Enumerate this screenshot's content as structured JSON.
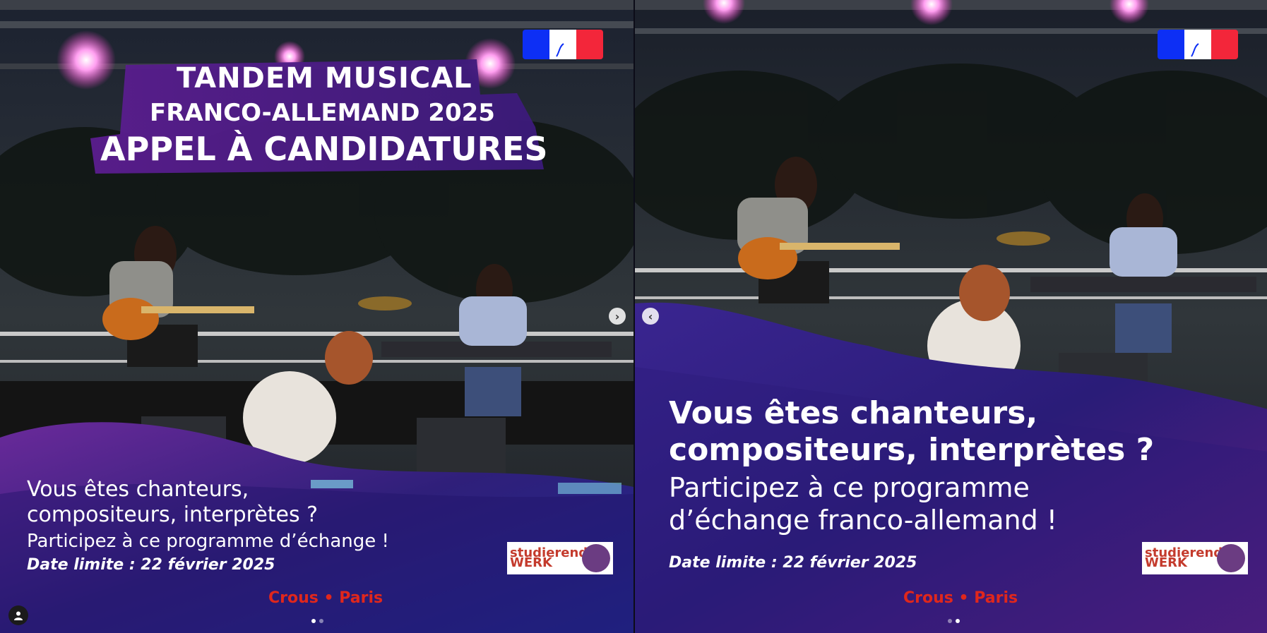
{
  "slide1": {
    "banner": {
      "line1": "TANDEM MUSICAL",
      "line2": "FRANCO-ALLEMAND 2025",
      "line3": "APPEL À CANDIDATURES"
    },
    "caption": {
      "line1": "Vous êtes chanteurs,",
      "line2": "compositeurs, interprètes ?",
      "line3": "Participez à ce programme d’échange !",
      "deadline": "Date limite : 22 février 2025"
    },
    "partner_logo_text": "studierenden WERK",
    "crous_text": "Crous • Paris",
    "next_arrow": "›"
  },
  "slide2": {
    "caption": {
      "line1": "Vous êtes chanteurs,",
      "line2": "compositeurs, interprètes ?",
      "line3": "Participez à ce programme",
      "line4": "d’échange franco-allemand !",
      "deadline": "Date limite : 22 février 2025"
    },
    "partner_logo_text": "studierenden WERK",
    "crous_text": "Crous • Paris",
    "prev_arrow": "‹"
  },
  "icons": {
    "user_tag": "user-icon",
    "flag": "french-republic-flag-icon"
  },
  "colors": {
    "purple_wave": "#3a1a8a",
    "magenta": "#b0278f",
    "crous_red": "#e0271c"
  }
}
